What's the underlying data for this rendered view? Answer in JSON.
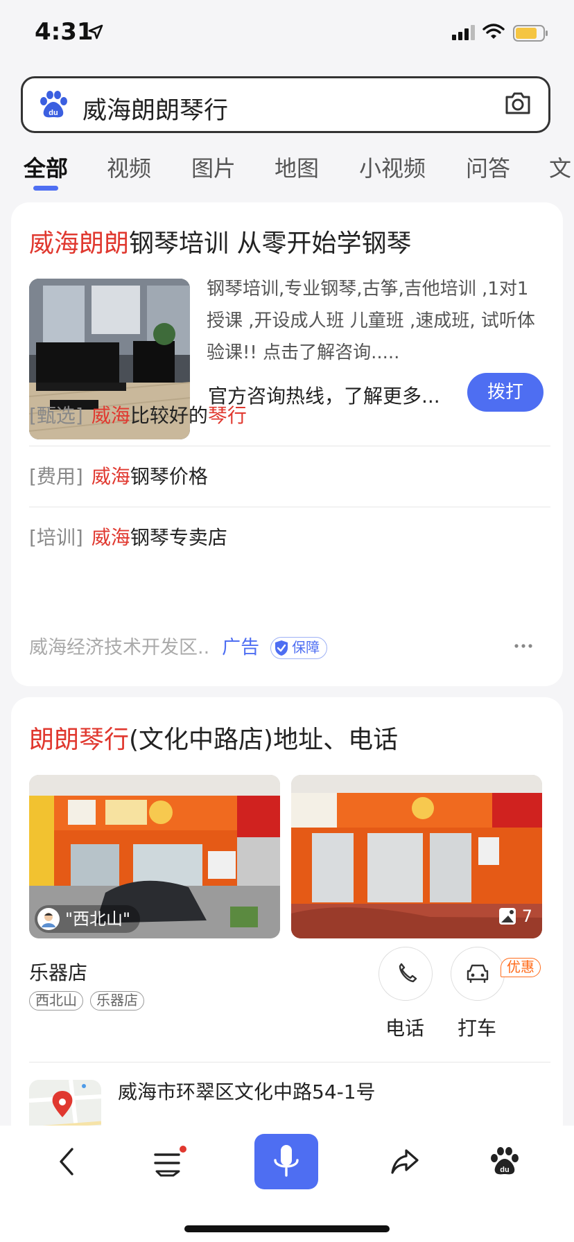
{
  "status_bar": {
    "time": "4:31"
  },
  "search": {
    "query": "威海朗朗琴行"
  },
  "tabs": [
    "全部",
    "视频",
    "图片",
    "地图",
    "小视频",
    "问答",
    "文"
  ],
  "ad_card": {
    "title_highlight": "威海朗朗",
    "title_rest": "钢琴培训 从零开始学钢琴",
    "description": "钢琴培训,专业钢琴,古筝,吉他培训 ,1对1授课 ,开设成人班 儿童班 ,速成班, 试听体验课!! 点击了解咨询.....",
    "hotline": "官方咨询热线，了解更多...",
    "call_label": "拨打",
    "sublinks": [
      {
        "tag": "[甄选]",
        "h1": "威海",
        "mid": "比较好的",
        "h2": "琴行"
      },
      {
        "tag": "[费用]",
        "h1": "威海",
        "mid": "钢琴价格",
        "h2": ""
      },
      {
        "tag": "[培训]",
        "h1": "威海",
        "mid": "钢琴专卖店",
        "h2": ""
      }
    ],
    "source": "威海经济技术开发区..",
    "ad_label": "广告",
    "guarantee": "保障"
  },
  "place_card": {
    "title_highlight": "朗朗琴行",
    "title_rest": "(文化中路店)地址、电话",
    "photo_user": "\"西北山\"",
    "photo_count": "7",
    "category": "乐器店",
    "chips": [
      "西北山",
      "乐器店"
    ],
    "phone_label": "电话",
    "taxi_label": "打车",
    "promo": "优惠",
    "address": "威海市环翠区文化中路54-1号"
  },
  "colors": {
    "accent": "#4e6ef2",
    "highlight": "#e0382f",
    "promo": "#ff6b1a"
  }
}
